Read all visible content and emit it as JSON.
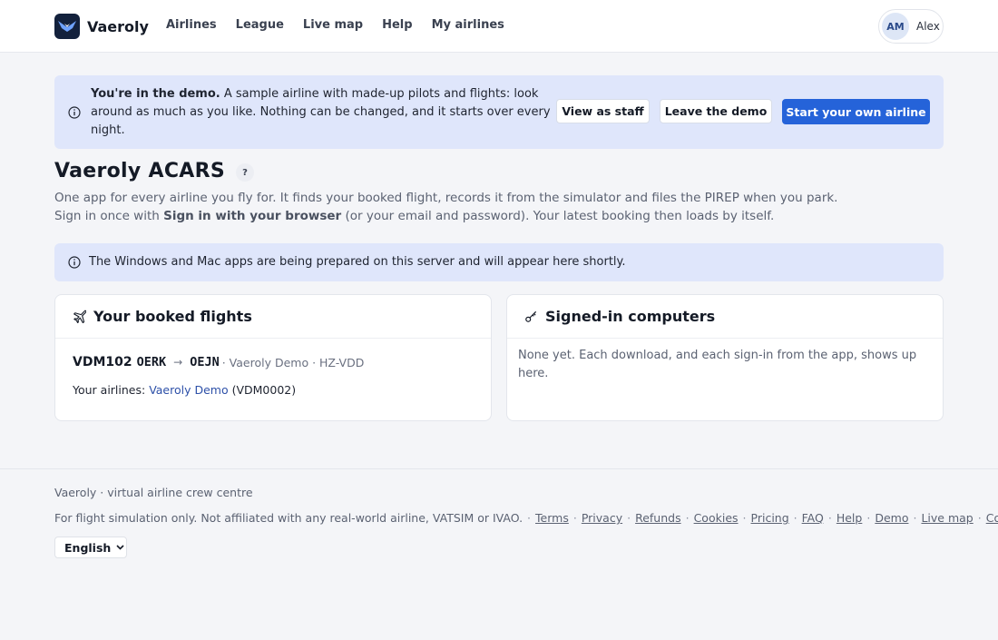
{
  "header": {
    "brand": "Vaeroly",
    "nav": [
      "Airlines",
      "League",
      "Live map",
      "Help",
      "My airlines"
    ],
    "user_initials": "AM",
    "user_name": "Alex"
  },
  "demo_banner": {
    "strong": "You're in the demo.",
    "text": " A sample airline with made-up pilots and flights: look around as much as you like. Nothing can be changed, and it starts over every night.",
    "view_as_staff": "View as staff",
    "leave_demo": "Leave the demo",
    "start_own": "Start your own airline"
  },
  "page": {
    "title": "Vaeroly ACARS",
    "help": "?",
    "desc_line1": "One app for every airline you fly for. It finds your booked flight, records it from the simulator and files the PIREP when you park.",
    "desc_line2_a": "Sign in once with ",
    "desc_line2_b": "Sign in with your browser",
    "desc_line2_c": " (or your email and password). Your latest booking then loads by itself."
  },
  "notice": {
    "text": "The Windows and Mac apps are being prepared on this server and will appear here shortly."
  },
  "booked_card": {
    "title": "Your booked flights",
    "flight_code": "VDM102",
    "origin": "OERK",
    "arrow": "→",
    "dest": "OEJN",
    "meta": " · Vaeroly Demo · HZ-VDD",
    "airlines_label": "Your airlines: ",
    "airline_link": "Vaeroly Demo",
    "airline_code": " (VDM0002)"
  },
  "computers_card": {
    "title": "Signed-in computers",
    "text": "None yet. Each download, and each sign-in from the app, shows up here."
  },
  "footer": {
    "line1": "Vaeroly · virtual airline crew centre",
    "disclaimer": "For flight simulation only. Not affiliated with any real-world airline, VATSIM or IVAO.",
    "links": [
      "Terms",
      "Privacy",
      "Refunds",
      "Cookies",
      "Pricing",
      "FAQ",
      "Help",
      "Demo",
      "Live map",
      "Contact"
    ],
    "language": "English"
  },
  "colors": {
    "accent": "#2563d9",
    "banner_bg": "#dfe6fb",
    "page_bg": "#f4f5f8",
    "logo_bg": "#13213c"
  },
  "icons": [
    "logo-wings-icon",
    "info-icon",
    "plane-icon",
    "key-icon",
    "chevron-down-icon"
  ]
}
